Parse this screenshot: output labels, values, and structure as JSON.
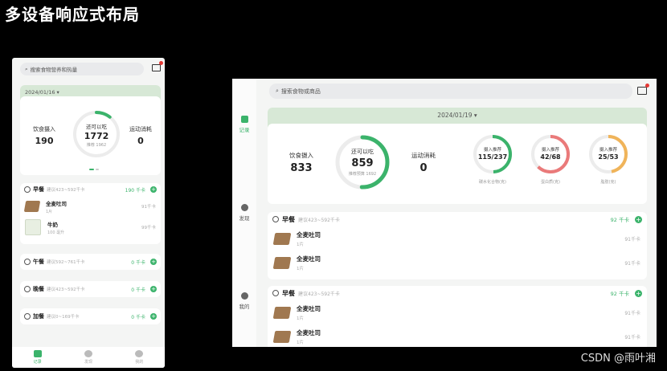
{
  "page_title": "多设备响应式布局",
  "watermark": "CSDN @雨叶湘",
  "colors": {
    "accent": "#3bb36b",
    "band": "#d7e8d6",
    "alert": "#e53935"
  },
  "phone": {
    "search_placeholder": "搜索食物营养和热量",
    "date": "2024/01/16 ▾",
    "intake_label": "饮食摄入",
    "intake_value": "190",
    "remain_label": "还可以吃",
    "remain_value": "1772",
    "remain_hint": "推荐 1962",
    "exercise_label": "运动消耗",
    "exercise_value": "0",
    "meals": [
      {
        "name": "早餐",
        "hint": "建议423~592千卡",
        "kcal": "190 千卡",
        "foods": [
          {
            "name": "全麦吐司",
            "qty": "1片",
            "kcal": "91千卡"
          },
          {
            "name": "牛奶",
            "qty": "100 毫升",
            "kcal": "99千卡"
          }
        ]
      },
      {
        "name": "午餐",
        "hint": "建议592~761千卡",
        "kcal": "0 千卡"
      },
      {
        "name": "晚餐",
        "hint": "建议423~592千卡",
        "kcal": "0 千卡"
      },
      {
        "name": "加餐",
        "hint": "建议0~169千卡",
        "kcal": "0 千卡"
      }
    ],
    "tabs": [
      "记录",
      "发现",
      "我的"
    ]
  },
  "tablet": {
    "search_placeholder": "搜索食物或商品",
    "date": "2024/01/19 ▾",
    "rail": [
      "记录",
      "发现",
      "我的"
    ],
    "intake_label": "饮食摄入",
    "intake_value": "833",
    "remain_label": "还可以吃",
    "remain_value": "859",
    "remain_hint": "推荐预算 1692",
    "exercise_label": "运动消耗",
    "exercise_value": "0",
    "nutrients": [
      {
        "label": "摄入推荐",
        "value": "115/237",
        "caption": "碳水化合物(克)",
        "color": "#3bb36b",
        "pct": 0.49
      },
      {
        "label": "摄入推荐",
        "value": "42/68",
        "caption": "蛋白质(克)",
        "color": "#ea7a7a",
        "pct": 0.62
      },
      {
        "label": "摄入推荐",
        "value": "25/53",
        "caption": "脂肪(克)",
        "color": "#f0b45a",
        "pct": 0.47
      }
    ],
    "meals": [
      {
        "name": "早餐",
        "hint": "建议423~592千卡",
        "kcal": "92 千卡",
        "foods": [
          {
            "name": "全麦吐司",
            "qty": "1片",
            "kcal": "91千卡"
          },
          {
            "name": "全麦吐司",
            "qty": "1片",
            "kcal": "91千卡"
          }
        ]
      },
      {
        "name": "早餐",
        "hint": "建议423~592千卡",
        "kcal": "92 千卡",
        "foods": [
          {
            "name": "全麦吐司",
            "qty": "1片",
            "kcal": "91千卡"
          },
          {
            "name": "全麦吐司",
            "qty": "1片",
            "kcal": "91千卡"
          }
        ]
      }
    ]
  }
}
